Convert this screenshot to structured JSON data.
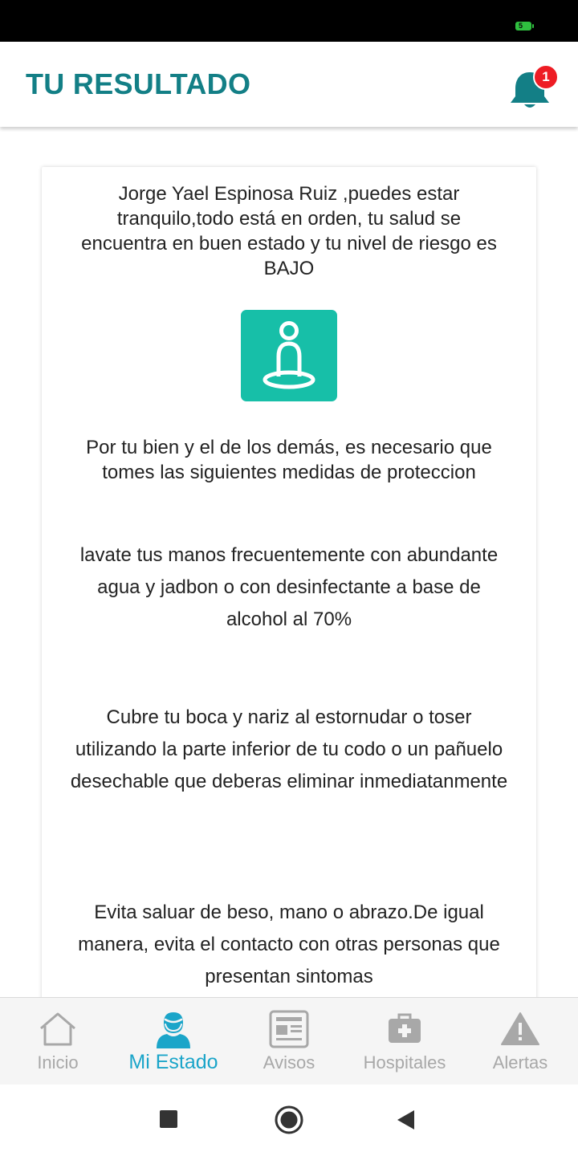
{
  "status_bar": {
    "battery_level": "5"
  },
  "header": {
    "title": "TU RESULTADO",
    "notification_count": "1"
  },
  "card": {
    "intro": "Jorge Yael Espinosa Ruiz ,puedes estar tranquilo,todo está en orden, tu salud se encuentra en buen estado y tu nivel de riesgo es BAJO",
    "advice_intro": "Por tu bien y el de los demás, es necesario que tomes las siguientes medidas de proteccion",
    "measures": [
      "lavate tus manos frecuentemente con abundante agua y jadbon o con desinfectante a base de alcohol al 70%",
      "Cubre tu boca y nariz al estornudar o toser utilizando la parte inferior de tu codo o un pañuelo desechable que deberas eliminar inmediatanmente",
      "Evita saluar de beso, mano o abrazo.De igual manera, evita el contacto con otras personas que presentan sintomas"
    ]
  },
  "bottom_nav": {
    "items": [
      {
        "label": "Inicio",
        "icon": "home-icon"
      },
      {
        "label": "Mi Estado",
        "icon": "person-icon",
        "active": true
      },
      {
        "label": "Avisos",
        "icon": "newspaper-icon"
      },
      {
        "label": "Hospitales",
        "icon": "first-aid-kit-icon"
      },
      {
        "label": "Alertas",
        "icon": "warning-icon"
      }
    ]
  },
  "colors": {
    "accent": "#137f86",
    "active_tab": "#1ba5c9",
    "inactive_tab": "#a8a8a8",
    "status_icon_bg": "#17bfa8",
    "badge": "#ee1c24"
  }
}
